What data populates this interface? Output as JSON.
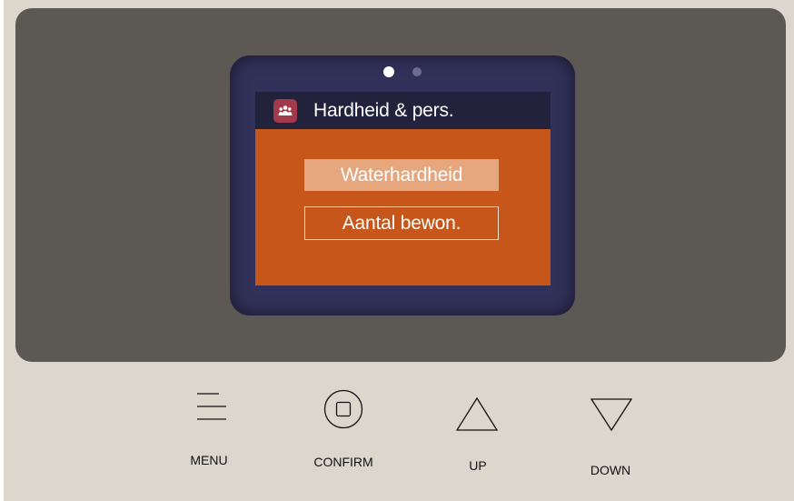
{
  "screen": {
    "page_indicator": {
      "pages": 2,
      "current": 1
    },
    "title": "Hardheid & pers.",
    "title_icon": "people-icon",
    "options": [
      {
        "label": "Waterhardheid",
        "selected": true
      },
      {
        "label": "Aantal bewon.",
        "selected": false
      }
    ]
  },
  "buttons": {
    "menu": {
      "label": "MENU",
      "icon": "menu-lines-icon"
    },
    "confirm": {
      "label": "CONFIRM",
      "icon": "confirm-circle-icon"
    },
    "up": {
      "label": "UP",
      "icon": "triangle-up-icon"
    },
    "down": {
      "label": "DOWN",
      "icon": "triangle-down-icon"
    }
  },
  "colors": {
    "bezel": "#5c5853",
    "casing": "#dcd6cd",
    "screen_frame": "#313058",
    "titlebar": "#22223d",
    "content_bg": "#c65619",
    "selected_option": "#e6a77f",
    "title_icon_bg": "#a23a4c"
  }
}
